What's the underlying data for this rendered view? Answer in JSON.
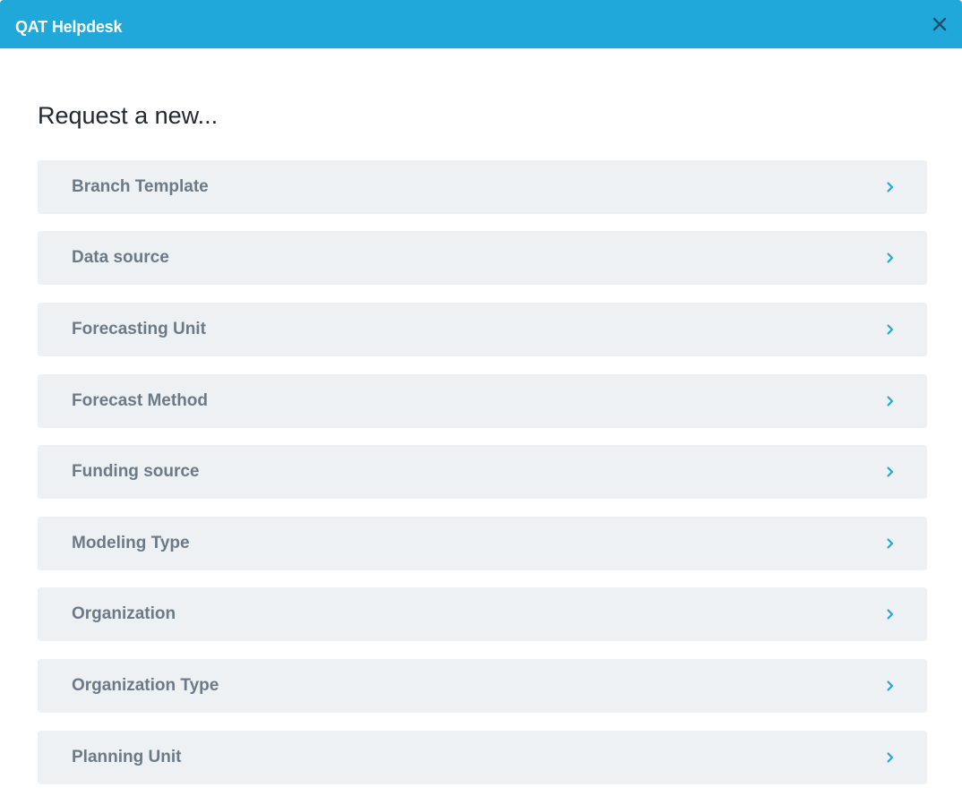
{
  "window": {
    "title": "QAT Helpdesk",
    "close_icon": "close-icon"
  },
  "main": {
    "heading": "Request a new...",
    "items": [
      {
        "label": "Branch Template"
      },
      {
        "label": "Data source"
      },
      {
        "label": "Forecasting Unit"
      },
      {
        "label": "Forecast Method"
      },
      {
        "label": "Funding source"
      },
      {
        "label": "Modeling Type"
      },
      {
        "label": "Organization"
      },
      {
        "label": "Organization Type"
      },
      {
        "label": "Planning Unit"
      }
    ],
    "chevron_icon": "chevron-right-icon"
  },
  "colors": {
    "header": "#21a8db",
    "item_bg": "#eef1f4",
    "item_text": "#6c7a87",
    "chevron": "#21a8db"
  }
}
